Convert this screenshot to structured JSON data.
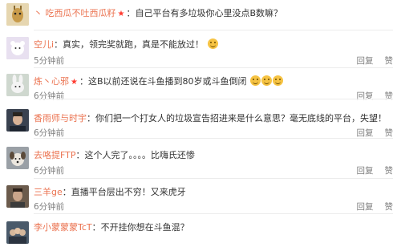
{
  "comments": [
    {
      "name": "吃西瓜不吐西瓜籽",
      "vip": true,
      "text": "自己平台有多垃圾你心里没点B数嘛？",
      "emoji_count": 0,
      "time": "",
      "actions": [],
      "avatar": "giraffe",
      "prefix": "丶"
    },
    {
      "name": "空儿i",
      "vip": false,
      "text": "真实，领完奖就跑，真是不能放过！",
      "emoji_count": 1,
      "time": "5分钟前",
      "actions": [
        "回复",
        "赞"
      ],
      "avatar": "bear",
      "prefix": ""
    },
    {
      "name": "炼丶心邪",
      "vip": true,
      "text": "这B以前还说在斗鱼播到80岁或斗鱼倒闭",
      "emoji_count": 3,
      "time": "6分钟前",
      "actions": [
        "回复",
        "赞"
      ],
      "avatar": "bunny",
      "prefix": ""
    },
    {
      "name": "香雨师与时宇",
      "vip": false,
      "text": "你们把一个打女人的垃圾宣告招进来是什么意思？毫无底线的平台，失望！",
      "emoji_count": 0,
      "time": "6分钟前",
      "actions": [
        "回复",
        "赞"
      ],
      "avatar": "man",
      "prefix": ""
    },
    {
      "name": "去咯提FTP",
      "vip": false,
      "text": "这个人完了。。。。比嗨氏还惨",
      "emoji_count": 0,
      "time": "6分钟前",
      "actions": [
        "回复",
        "赞"
      ],
      "avatar": "dog",
      "prefix": ""
    },
    {
      "name": "三羊ge",
      "vip": false,
      "text": "直播平台层出不穷！又来虎牙",
      "emoji_count": 0,
      "time": "6分钟前",
      "actions": [
        "回复",
        "赞"
      ],
      "avatar": "person",
      "prefix": ""
    },
    {
      "name": "李小蒙蒙蒙TcT",
      "vip": false,
      "text": "不开挂你想在斗鱼混？",
      "emoji_count": 0,
      "time": "",
      "actions": [],
      "avatar": "group",
      "prefix": ""
    }
  ],
  "colors": {
    "name": "#eb7350",
    "text": "#333333",
    "meta": "#808080"
  }
}
